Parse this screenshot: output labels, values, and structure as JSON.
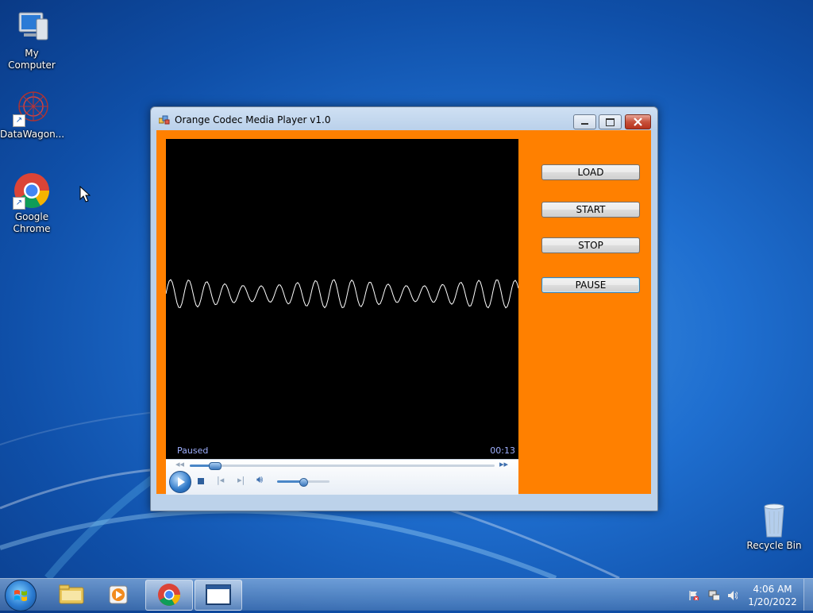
{
  "desktop": {
    "icons": [
      {
        "label": "My Computer",
        "icon": "computer-icon"
      },
      {
        "label": "DataWagon...",
        "icon": "datawagon-icon"
      },
      {
        "label": "Google Chrome",
        "icon": "chrome-icon"
      },
      {
        "label": "Recycle Bin",
        "icon": "recycle-bin-icon"
      }
    ]
  },
  "window": {
    "title": "Orange Codec Media Player v1.0",
    "colors": {
      "client_background": "#ff8000",
      "video_background": "#000000"
    },
    "player": {
      "status": "Paused",
      "time": "00:13",
      "seek_progress": 0.08,
      "volume_level": 0.5
    },
    "buttons": {
      "load": "LOAD",
      "start": "START",
      "stop": "STOP",
      "pause": "PAUSE"
    }
  },
  "taskbar": {
    "clock": {
      "time": "4:06 AM",
      "date": "1/20/2022"
    },
    "pinned": [
      "explorer-icon",
      "media-player-icon",
      "chrome-icon",
      "window-icon"
    ]
  }
}
